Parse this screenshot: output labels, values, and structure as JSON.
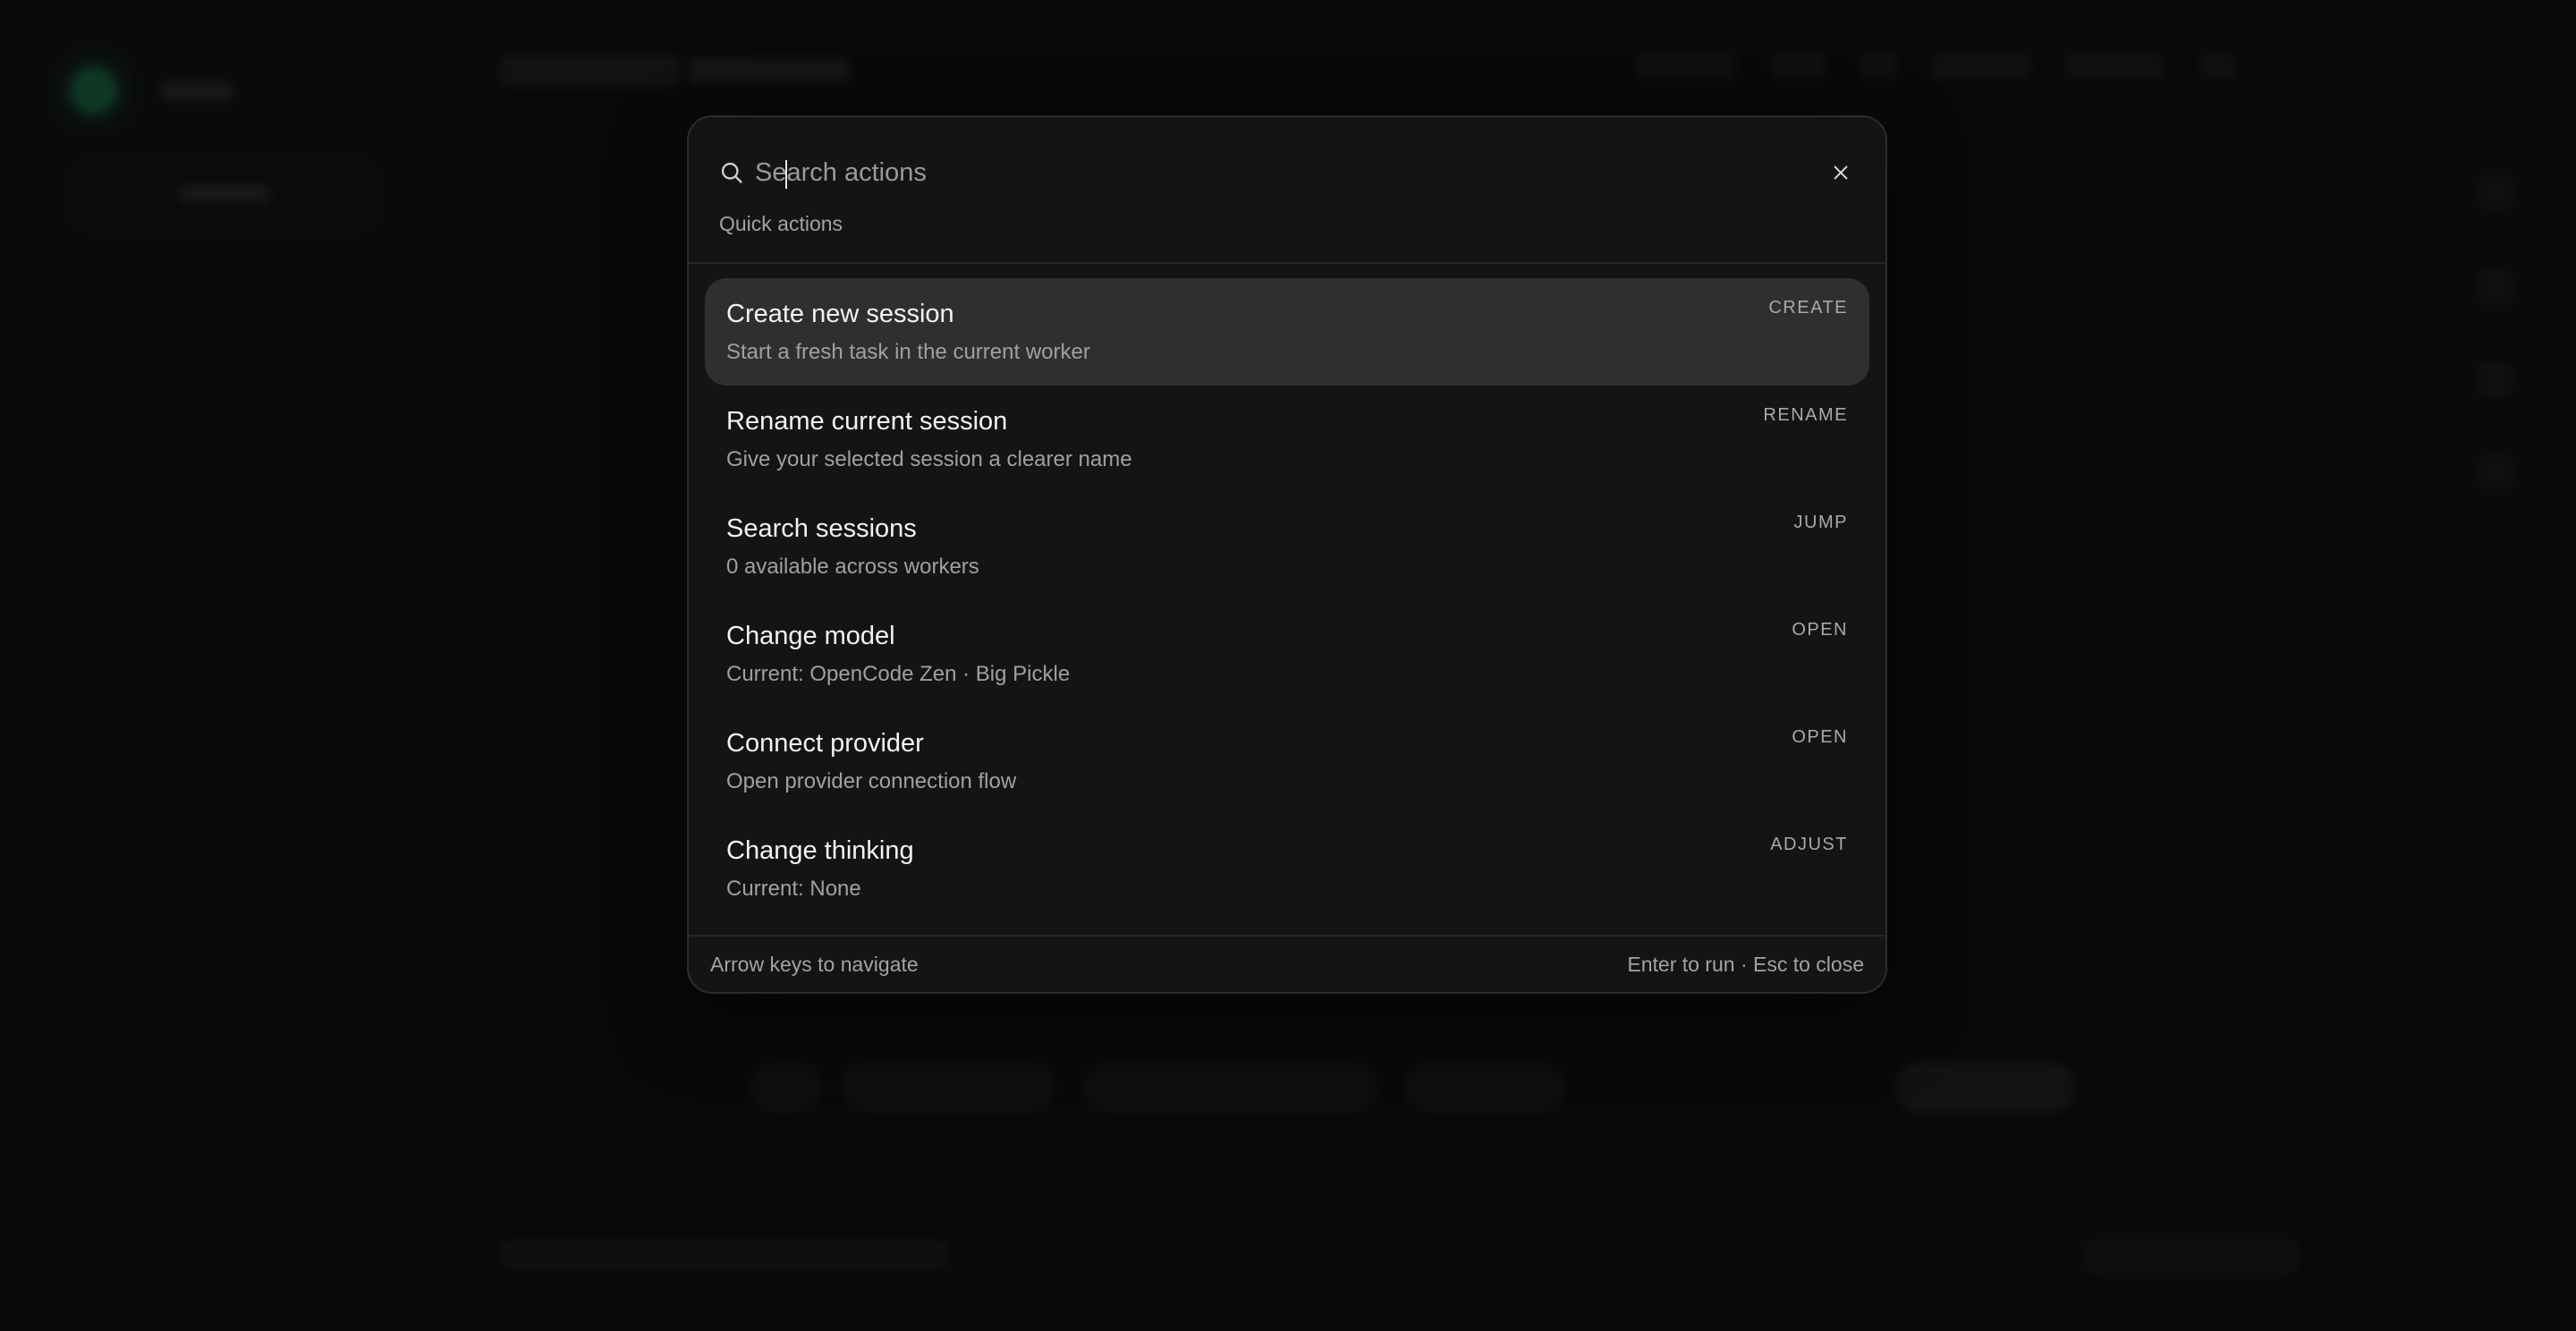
{
  "palette": {
    "search": {
      "placeholder": "Search actions",
      "value": ""
    },
    "section_label": "Quick actions",
    "items": [
      {
        "title": "Create new session",
        "subtitle": "Start a fresh task in the current worker",
        "tag": "CREATE"
      },
      {
        "title": "Rename current session",
        "subtitle": "Give your selected session a clearer name",
        "tag": "RENAME"
      },
      {
        "title": "Search sessions",
        "subtitle": "0 available across workers",
        "tag": "JUMP"
      },
      {
        "title": "Change model",
        "subtitle": "Current: OpenCode Zen · Big Pickle",
        "tag": "OPEN"
      },
      {
        "title": "Connect provider",
        "subtitle": "Open provider connection flow",
        "tag": "OPEN"
      },
      {
        "title": "Change thinking",
        "subtitle": "Current: None",
        "tag": "ADJUST"
      }
    ],
    "footer": {
      "hint_left": "Arrow keys to navigate",
      "hint_right": "Enter to run · Esc to close"
    }
  },
  "colors": {
    "overlay_bg": "#0f0f0f",
    "panel_bg": "#141414",
    "active_row_bg": "#2f2f2f",
    "brand_accent": "#1f8f5f"
  },
  "icons": [
    "search-icon",
    "close-icon"
  ]
}
